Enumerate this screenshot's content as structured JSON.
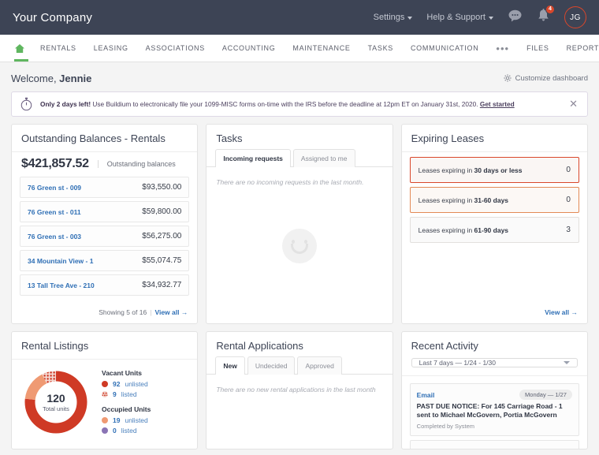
{
  "topbar": {
    "company": "Your Company",
    "settings": "Settings",
    "help": "Help & Support",
    "chat_icon": "chat-bubble-icon",
    "bell_icon": "bell-icon",
    "notification_count": "4",
    "avatar_initials": "JG"
  },
  "nav": {
    "home_icon": "home-icon",
    "items": [
      {
        "label": "RENTALS"
      },
      {
        "label": "LEASING"
      },
      {
        "label": "ASSOCIATIONS"
      },
      {
        "label": "ACCOUNTING"
      },
      {
        "label": "MAINTENANCE"
      },
      {
        "label": "TASKS"
      },
      {
        "label": "COMMUNICATION"
      }
    ],
    "more": "•••",
    "right_items": [
      {
        "label": "FILES"
      },
      {
        "label": "REPORTS"
      }
    ],
    "search_icon": "search-icon"
  },
  "welcome": {
    "prefix": "Welcome, ",
    "name": "Jennie",
    "customize": "Customize dashboard",
    "gear_icon": "gear-icon"
  },
  "banner": {
    "stopwatch_icon": "stopwatch-icon",
    "bold": "Only 2 days left!",
    "text": " Use Buildium to electronically file your 1099-MISC forms on-time with the IRS before the deadline at 12pm ET on January 31st, 2020. ",
    "link": "Get started",
    "close_icon": "close-icon",
    "accent": "#4b3f5e"
  },
  "outstanding_balances": {
    "title": "Outstanding Balances - Rentals",
    "amount": "$421,857.52",
    "amount_label": "Outstanding balances",
    "rows": [
      {
        "name": "76 Green st - 009",
        "value": "$93,550.00"
      },
      {
        "name": "76 Green st - 011",
        "value": "$59,800.00"
      },
      {
        "name": "76 Green st - 003",
        "value": "$56,275.00"
      },
      {
        "name": "34 Mountain View - 1",
        "value": "$55,074.75"
      },
      {
        "name": "13 Tall Tree Ave - 210",
        "value": "$34,932.77"
      }
    ],
    "showing": "Showing 5 of 16",
    "view_all": "View all →"
  },
  "tasks": {
    "title": "Tasks",
    "tabs": [
      {
        "label": "Incoming requests",
        "active": true
      },
      {
        "label": "Assigned to me",
        "active": false
      }
    ],
    "empty": "There are no incoming requests in the last month."
  },
  "expiring_leases": {
    "title": "Expiring Leases",
    "rows": [
      {
        "prefix": "Leases expiring in ",
        "emphasis": "30 days or less",
        "count": "0",
        "state": "critical"
      },
      {
        "prefix": "Leases expiring in ",
        "emphasis": "31-60 days",
        "count": "0",
        "state": "warn"
      },
      {
        "prefix": "Leases expiring in ",
        "emphasis": "61-90 days",
        "count": "3",
        "state": "normal"
      }
    ],
    "view_all": "View all →",
    "critical_color": "#d9472b",
    "warn_color": "#e38a55"
  },
  "rental_listings": {
    "title": "Rental Listings",
    "legend_groups": [
      {
        "title": "Vacant Units",
        "items": [
          {
            "num": "92",
            "word": "unlisted",
            "color": "#cf3a25",
            "pattern": "solid"
          },
          {
            "num": "9",
            "word": "listed",
            "color": "#cf3a25",
            "pattern": "dotted"
          }
        ]
      },
      {
        "title": "Occupied Units",
        "items": [
          {
            "num": "19",
            "word": "unlisted",
            "color": "#ef9a73",
            "pattern": "solid"
          },
          {
            "num": "0",
            "word": "listed",
            "color": "#8a74b5",
            "pattern": "solid"
          }
        ]
      }
    ]
  },
  "chart_data": {
    "type": "pie",
    "title": "Rental Listings",
    "center_value": "120",
    "center_label": "Total units",
    "total": 120,
    "legend_position": "right",
    "slices": [
      {
        "label": "Vacant Units — unlisted",
        "value": 92,
        "color": "#cf3a25",
        "pattern": "solid"
      },
      {
        "label": "Occupied Units — unlisted",
        "value": 19,
        "color": "#ef9a73",
        "pattern": "solid"
      },
      {
        "label": "Vacant Units — listed",
        "value": 9,
        "color": "#cf3a25",
        "pattern": "dotted"
      },
      {
        "label": "Occupied Units — listed",
        "value": 0,
        "color": "#8a74b5",
        "pattern": "solid"
      }
    ]
  },
  "rental_applications": {
    "title": "Rental Applications",
    "tabs": [
      {
        "label": "New",
        "active": true
      },
      {
        "label": "Undecided",
        "active": false
      },
      {
        "label": "Approved",
        "active": false
      }
    ],
    "empty": "There are no new rental applications in the last month"
  },
  "recent_activity": {
    "title": "Recent Activity",
    "range": "Last 7 days — 1/24 - 1/30",
    "items": [
      {
        "type": "Email",
        "date": "Monday — 1/27",
        "description": "PAST DUE NOTICE: For 145 Carriage Road - 1 sent to Michael McGovern, Portia McGovern",
        "meta": "Completed by System"
      }
    ]
  }
}
